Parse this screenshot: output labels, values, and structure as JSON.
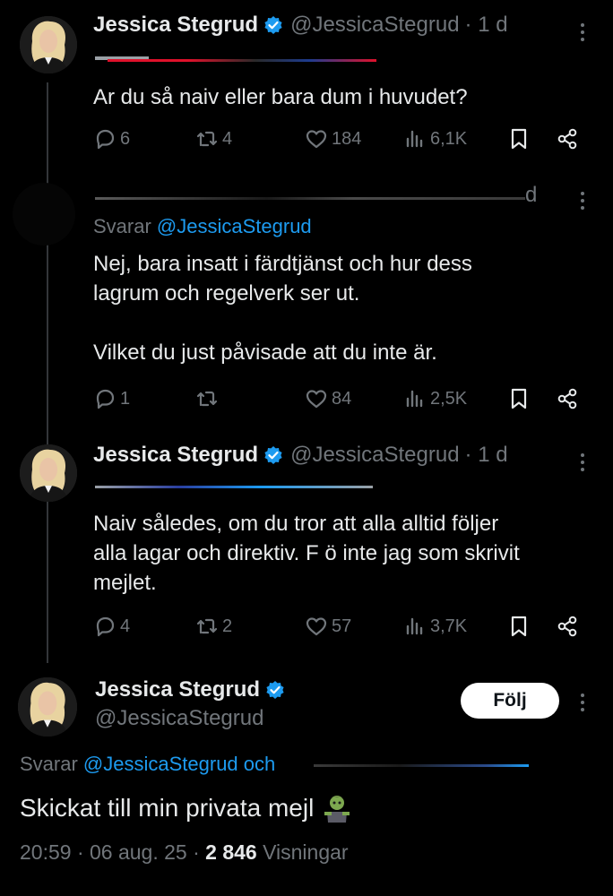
{
  "tweets": [
    {
      "name": "Jessica Stegrud",
      "handle": "@JessicaStegrud",
      "time": "· 1 d",
      "text": "Ar du så naiv eller bara dum i huvudet?",
      "replies": "6",
      "reposts": "4",
      "likes": "184",
      "views": "6,1K"
    },
    {
      "time": "d",
      "replying_prefix": "Svarar",
      "replying_handle": "@JessicaStegrud",
      "text": "Nej, bara insatt i färdtjänst och hur dess\nlagrum och regelverk ser ut.\n\nVilket du just påvisade att du inte är.",
      "replies": "1",
      "reposts": "",
      "likes": "84",
      "views": "2,5K"
    },
    {
      "name": "Jessica Stegrud",
      "handle": "@JessicaStegrud",
      "time": "· 1 d",
      "text": "Naiv således, om du tror att alla alltid följer\nalla lagar och direktiv. F ö inte jag som skrivit\nmejlet.",
      "replies": "4",
      "reposts": "2",
      "likes": "57",
      "views": "3,7K"
    }
  ],
  "main": {
    "name": "Jessica Stegrud",
    "handle": "@JessicaStegrud",
    "follow_label": "Följ",
    "replying_prefix": "Svarar",
    "replying_handle": "@JessicaStegrud och",
    "text": "Skickat till min privata mejl",
    "timestamp": "20:59 · 06 aug. 25 · ",
    "views_count": "2 846",
    "views_label": " Visningar"
  },
  "colors": {
    "background": "#000000",
    "text": "#e7e9ea",
    "muted": "#71767b",
    "accent": "#1d9bf0"
  },
  "icons": [
    "verified-badge-icon",
    "more-icon",
    "reply-icon",
    "repost-icon",
    "like-icon",
    "views-icon",
    "bookmark-icon",
    "share-icon",
    "zombie-emoji-icon"
  ]
}
